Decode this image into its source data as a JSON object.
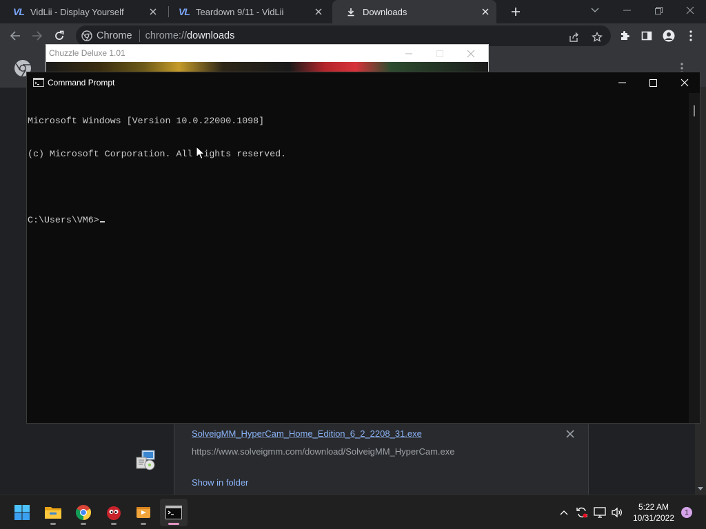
{
  "browser": {
    "tabs": [
      {
        "title": "VidLii - Display Yourself",
        "favicon": "vidlii-logo-icon",
        "active": false
      },
      {
        "title": "Teardown 9/11 - VidLii",
        "favicon": "vidlii-logo-icon",
        "active": false
      },
      {
        "title": "Downloads",
        "favicon": "download-icon",
        "active": true
      }
    ],
    "favicon_text": "VL",
    "omnibox": {
      "site_chip": "Chrome",
      "url_scheme": "chrome://",
      "url_host": "downloads"
    }
  },
  "downloads": {
    "item": {
      "filename": "SolveigMM_HyperCam_Home_Edition_6_2_2208_31.exe",
      "url": "https://www.solveigmm.com/download/SolveigMM_HyperCam.exe",
      "show_in_folder": "Show in folder"
    }
  },
  "chuzzle": {
    "title": "Chuzzle Deluxe 1.01"
  },
  "cmd": {
    "title": "Command Prompt",
    "lines": [
      "Microsoft Windows [Version 10.0.22000.1098]",
      "(c) Microsoft Corporation. All rights reserved.",
      "",
      "C:\\Users\\VM6>"
    ]
  },
  "taskbar": {
    "apps": [
      "start-icon",
      "file-explorer-icon",
      "chrome-icon",
      "chuzzle-icon",
      "media-player-icon",
      "command-prompt-icon"
    ],
    "clock": {
      "time": "5:22 AM",
      "date": "10/31/2022"
    },
    "notification_count": "1"
  },
  "colors": {
    "accent_link": "#8ab4f8",
    "cmd_bg": "#0c0c0c",
    "taskbar_bg": "#202020",
    "chrome_toolbar": "#35363a"
  }
}
